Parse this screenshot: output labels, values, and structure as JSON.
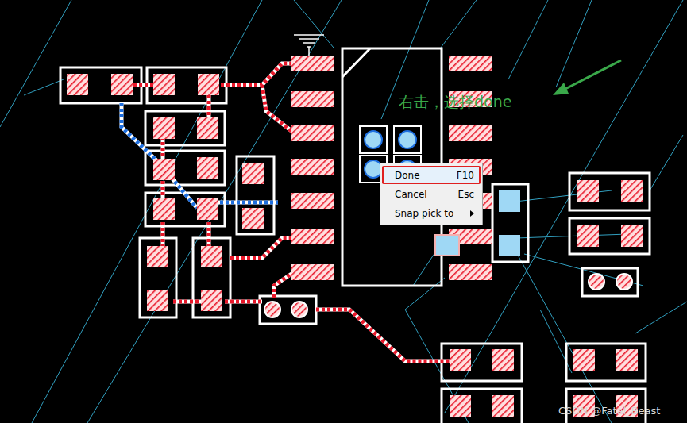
{
  "canvas": {
    "annotation": "右击，选择done"
  },
  "context_menu": {
    "items": [
      {
        "label": "Done",
        "shortcut": "F10",
        "selected": true,
        "submenu": false
      },
      {
        "label": "Cancel",
        "shortcut": "Esc",
        "selected": false,
        "submenu": false
      },
      {
        "label": "Snap pick to",
        "shortcut": "",
        "selected": false,
        "submenu": true
      }
    ]
  },
  "watermark": "CSDN @Fatal_Beast"
}
